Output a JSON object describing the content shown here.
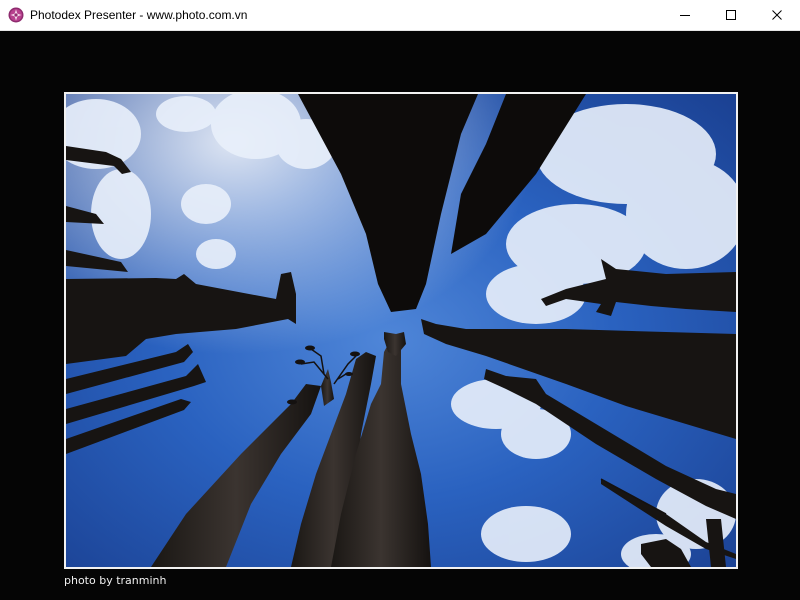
{
  "window": {
    "title": "Photodex Presenter - www.photo.com.vn",
    "app_icon": "photodex-logo-icon",
    "controls": {
      "minimize": "minimize-icon",
      "maximize": "maximize-icon",
      "close": "close-icon"
    }
  },
  "viewer": {
    "background_color": "#050505",
    "photo": {
      "subject_icon": "photo-image",
      "frame_color": "#f2f2f2"
    },
    "caption": "photo by tranminh"
  }
}
